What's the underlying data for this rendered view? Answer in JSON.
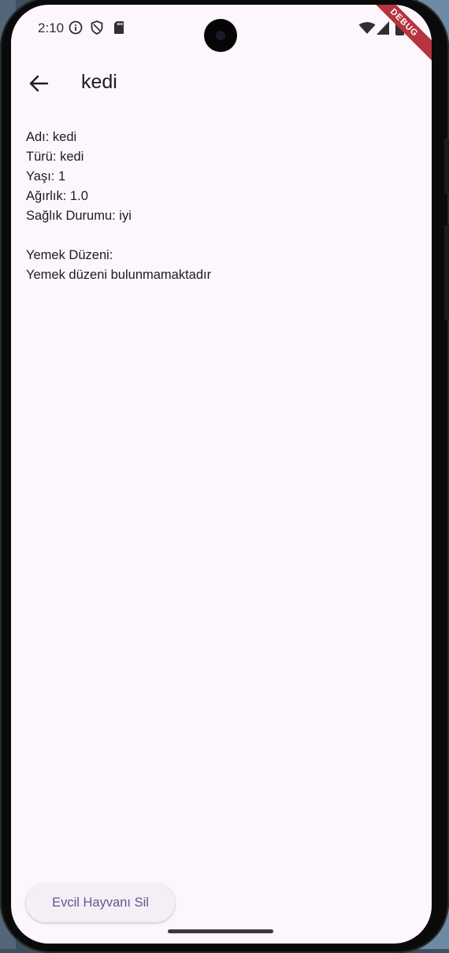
{
  "status_bar": {
    "time": "2:10",
    "icons": [
      "info-icon",
      "shield-icon",
      "sd-card-icon",
      "wifi-icon",
      "cell-signal-icon",
      "battery-icon"
    ]
  },
  "debug_banner": "DEBUG",
  "app_bar": {
    "back_icon": "arrow-back-icon",
    "title": "kedi"
  },
  "pet": {
    "name_line": "Adı: kedi",
    "type_line": "Türü: kedi",
    "age_line": "Yaşı: 1",
    "weight_line": "Ağırlık: 1.0",
    "health_line": "Sağlık Durumu: iyi"
  },
  "feeding": {
    "heading": "Yemek Düzeni:",
    "empty_message": "Yemek düzeni bulunmamaktadır"
  },
  "actions": {
    "delete_label": "Evcil Hayvanı Sil"
  },
  "colors": {
    "background": "#fdf6fd",
    "button_text": "#65558f",
    "debug_banner": "#b5343e"
  }
}
